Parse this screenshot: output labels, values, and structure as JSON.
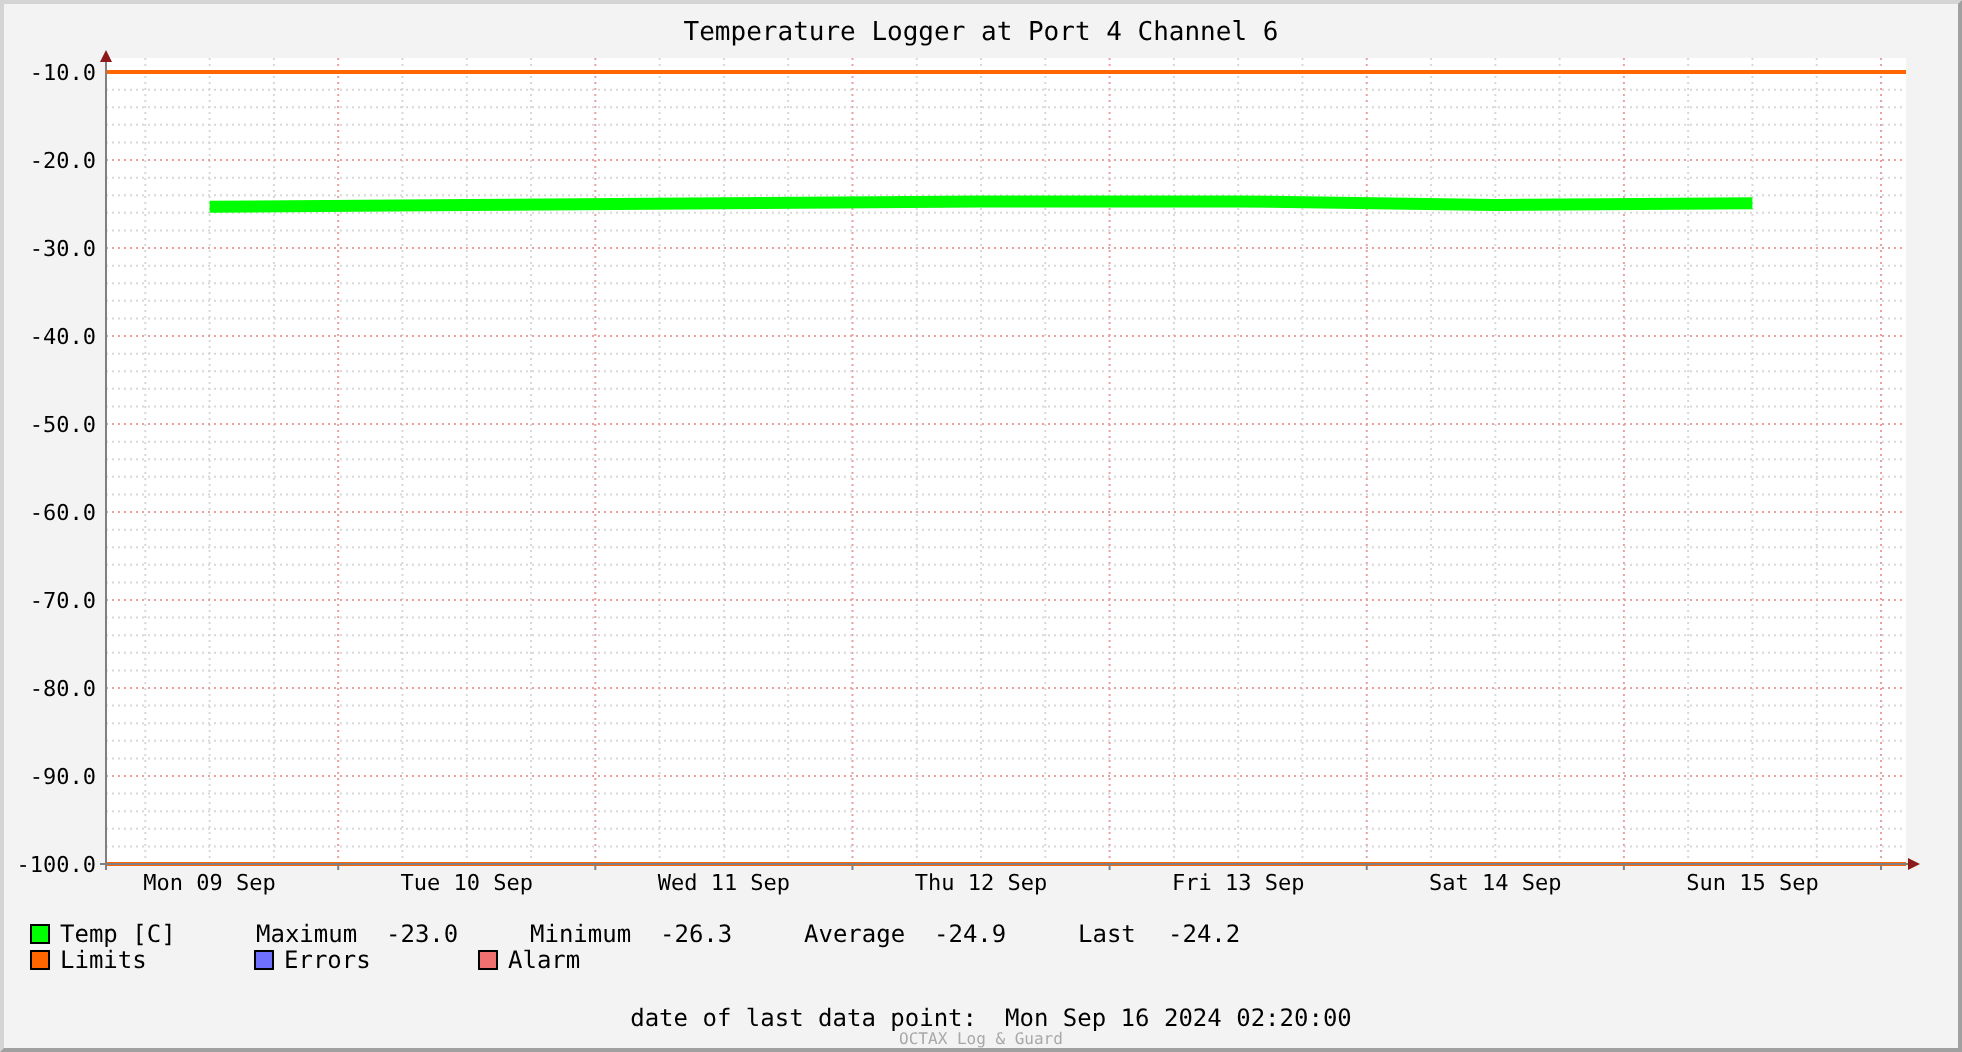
{
  "title": "Temperature Logger at Port 4 Channel 6",
  "chart_data": {
    "type": "line",
    "categories": [
      "Mon 09 Sep",
      "Tue 10 Sep",
      "Wed 11 Sep",
      "Thu 12 Sep",
      "Fri 13 Sep",
      "Sat 14 Sep",
      "Sun 15 Sep"
    ],
    "ylim": [
      -100,
      -8.4
    ],
    "yticks": [
      {
        "value": -10,
        "label": "-10.0"
      },
      {
        "value": -20,
        "label": "-20.0"
      },
      {
        "value": -30,
        "label": "-30.0"
      },
      {
        "value": -40,
        "label": "-40.0"
      },
      {
        "value": -50,
        "label": "-50.0"
      },
      {
        "value": -60,
        "label": "-60.0"
      },
      {
        "value": -70,
        "label": "-70.0"
      },
      {
        "value": -80,
        "label": "-80.0"
      },
      {
        "value": -90,
        "label": "-90.0"
      },
      {
        "value": -100,
        "label": "-100.0"
      }
    ],
    "series": [
      {
        "name": "Temp [C]",
        "color": "#00ff00",
        "values": [
          -25.3,
          -25.1,
          -24.9,
          -24.7,
          -24.7,
          -25.1,
          -24.9
        ]
      }
    ],
    "grid": true,
    "ref_lines": [
      {
        "axis": "y",
        "value": -10
      },
      {
        "axis": "y",
        "value": -100
      }
    ]
  },
  "stats": [
    {
      "label": "Maximum",
      "value": "-23.0"
    },
    {
      "label": "Minimum",
      "value": "-26.3"
    },
    {
      "label": "Average",
      "value": "-24.9"
    },
    {
      "label": "Last",
      "value": "-24.2"
    }
  ],
  "legend": [
    {
      "label": "Limits",
      "color": "#ff6600"
    },
    {
      "label": "Errors",
      "color": "#7070ff"
    },
    {
      "label": "Alarm",
      "color": "#f07070"
    }
  ],
  "last_data_point": {
    "label": "date of last data point:",
    "value": "Mon Sep 16 2024 02:20:00"
  },
  "credit": "OCTAX Log & Guard"
}
